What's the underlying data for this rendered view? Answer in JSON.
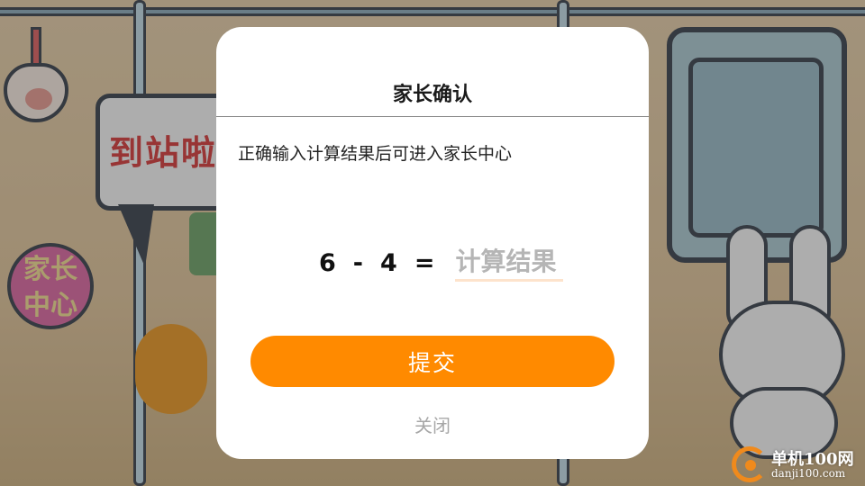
{
  "background": {
    "speech_bubble_text": "到站啦",
    "parent_center_button_label": "家长中心"
  },
  "dialog": {
    "title": "家长确认",
    "description": "正确输入计算结果后可进入家长中心",
    "equation": {
      "operand_a": "6",
      "operator": "-",
      "operand_b": "4",
      "equals": "=",
      "answer_value": "",
      "answer_placeholder": "计算结果"
    },
    "submit_label": "提交",
    "close_label": "关闭",
    "accent_color": "#ff8a00"
  },
  "watermark": {
    "name": "单机100网",
    "url": "danji100.com"
  }
}
